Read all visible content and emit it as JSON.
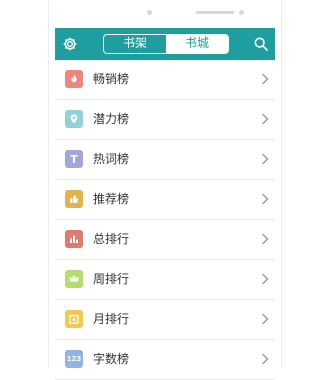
{
  "header": {
    "tabs": [
      {
        "label": "书架",
        "active": false
      },
      {
        "label": "书城",
        "active": true
      }
    ],
    "icons": {
      "left": "gear-icon",
      "right": "search-icon"
    },
    "accent": "#1e9e9e"
  },
  "list": {
    "items": [
      {
        "label": "畅销榜",
        "icon": "fire-icon",
        "color": "#f0857a"
      },
      {
        "label": "潜力榜",
        "icon": "location-pin-icon",
        "color": "#8fd3d8"
      },
      {
        "label": "热词榜",
        "icon": "text-t-icon",
        "color": "#9fa8d8",
        "glyph": "T"
      },
      {
        "label": "推荐榜",
        "icon": "thumbs-up-icon",
        "color": "#e4b24c"
      },
      {
        "label": "总排行",
        "icon": "bar-chart-icon",
        "color": "#e07a70"
      },
      {
        "label": "周排行",
        "icon": "crown-icon",
        "color": "#b4dd6e"
      },
      {
        "label": "月排行",
        "icon": "calendar-icon",
        "color": "#f2c94c"
      },
      {
        "label": "字数榜",
        "icon": "numbers-icon",
        "color": "#8fb4e6",
        "glyph": "123"
      }
    ]
  }
}
